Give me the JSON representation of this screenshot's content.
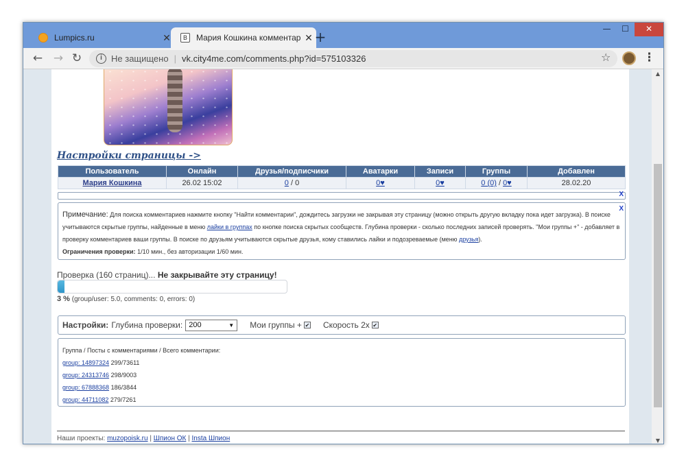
{
  "browser": {
    "tabs": [
      {
        "title": "Lumpics.ru",
        "close": "✕"
      },
      {
        "title": "Мария Кошкина комментарии ·",
        "close": "✕"
      }
    ],
    "new_tab": "+",
    "window_controls": {
      "minimize": "—",
      "maximize": "☐",
      "close": "✕"
    },
    "nav": {
      "back": "←",
      "forward": "→",
      "reload": "↻"
    },
    "address": {
      "security": "Не защищено",
      "url": "vk.city4me.com/comments.php?id=575103326"
    },
    "icons": {
      "star": "☆",
      "menu": "⋮",
      "info": "i"
    }
  },
  "page": {
    "settings_link": "Настройки страницы ->",
    "user_table": {
      "headers": [
        "Пользователь",
        "Онлайн",
        "Друзья/подписчики",
        "Аватарки",
        "Записи",
        "Группы",
        "Добавлен"
      ],
      "row": {
        "user": "Мария Кошкина",
        "online": "26.02 15:02",
        "friends": "0",
        "friends_sep": " / ",
        "followers": "0",
        "avatars": "0♥",
        "posts": "0♥",
        "groups_a": "0 (0)",
        "groups_sep": " / ",
        "groups_b": "0♥",
        "added": "28.02.20"
      }
    },
    "close_x": "X",
    "note": {
      "title": "Примечание:",
      "text1": " Для поиска комментариев нажмите кнопку \"Найти комментарии\", дождитесь загрузки не закрывая эту страницу (можно открыть другую вкладку пока идет загрузка). В поиске учитываются скрытые группы, найденные в меню ",
      "link1": "лайки в группах",
      "text2": " по кнопке поиска скрытых сообществ. Глубина проверки - сколько последних записей проверять. \"Мои группы +\" - добавляет в проверку комментариев ваши группы. В поиске по друзьям учитываются скрытые друзья, кому ставились лайки и подозреваемые (меню ",
      "link2": "друзья",
      "text3": ").",
      "limits_label": "Ограничения проверки:",
      "limits_text": " 1/10 мин., без авторизации 1/60 мин."
    },
    "progress": {
      "label": "Проверка (160 страниц)... ",
      "warning": "Не закрывайте эту страницу!",
      "percent": 3,
      "percent_text": "3 %",
      "stats": " (group/user: 5.0, comments: 0, errors: 0)"
    },
    "settings": {
      "title": "Настройки:",
      "depth_label": "Глубина проверки:",
      "depth_value": "200",
      "my_groups_label": "Мои группы +",
      "my_groups_checked": true,
      "speed_label": "Скорость 2x",
      "speed_checked": true,
      "check_mark": "✔",
      "caret": "▼"
    },
    "groups": {
      "header": "Группа / Посты с комментариями / Всего комментарии:",
      "items": [
        {
          "link": "group: 14897324",
          "stats": " 299/73611"
        },
        {
          "link": "group: 24313746",
          "stats": " 298/9003"
        },
        {
          "link": "group: 67888368",
          "stats": " 186/3844"
        },
        {
          "link": "group: 44711082",
          "stats": " 279/7261"
        }
      ]
    },
    "footer": {
      "label": "Наши проекты: ",
      "links": [
        "muzopoisk.ru",
        "Шпион ОК",
        "Insta Шпион"
      ],
      "sep": " | "
    }
  },
  "colors": {
    "table_header": "#4a6b96",
    "tab_strip": "#6f9ad9",
    "progress": "#3fa6d6",
    "link": "#1a3fa0"
  }
}
